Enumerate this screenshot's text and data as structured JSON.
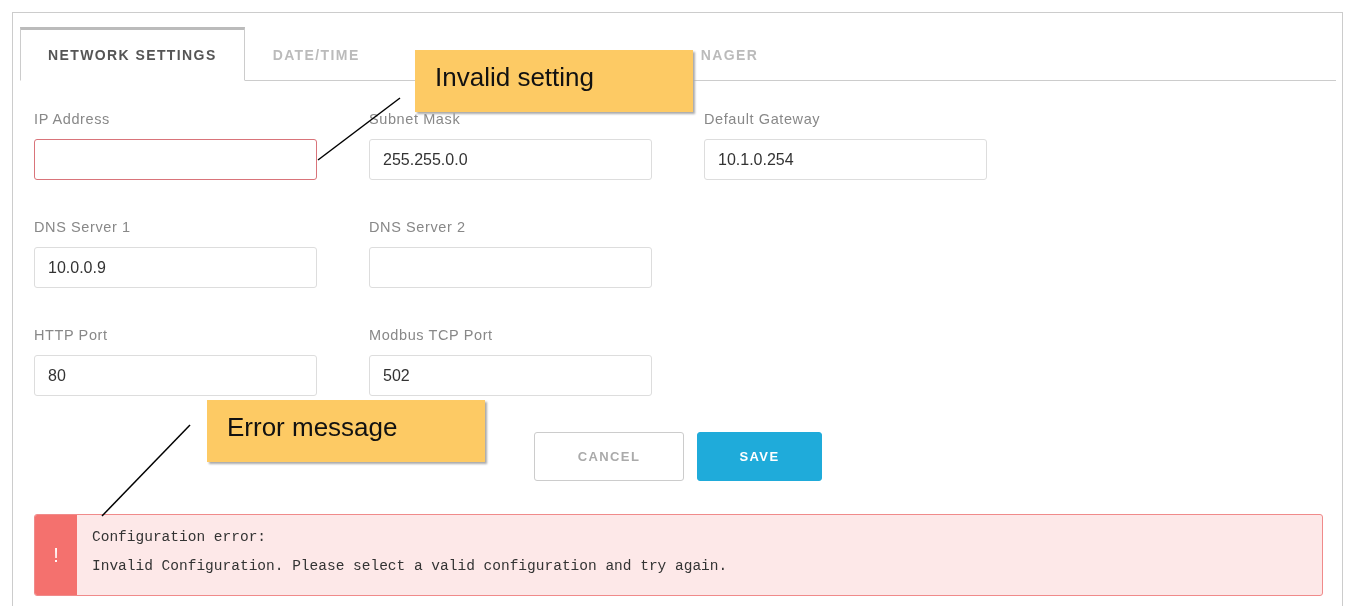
{
  "tabs": [
    {
      "label": "NETWORK SETTINGS",
      "selected": true
    },
    {
      "label": "DATE/TIME",
      "selected": false
    },
    {
      "label": "NAGER",
      "selected": false
    }
  ],
  "form": {
    "rows": [
      {
        "fields": [
          {
            "label": "IP Address",
            "invalid": true
          },
          {
            "label": "Subnet Mask",
            "value": "255.255.0.0",
            "invalid": false
          },
          {
            "label": "Default Gateway",
            "value": "10.1.0.254",
            "invalid": false
          }
        ]
      },
      {
        "fields": [
          {
            "label": "DNS Server 1",
            "value": "10.0.0.9",
            "invalid": false
          },
          {
            "label": "DNS Server 2",
            "invalid": false
          }
        ]
      },
      {
        "fields": [
          {
            "label": "HTTP Port",
            "value": "80",
            "invalid": false
          },
          {
            "label": "Modbus TCP Port",
            "value": "502",
            "invalid": false
          }
        ]
      }
    ]
  },
  "buttons": [
    {
      "label": "CANCEL",
      "kind": "secondary"
    },
    {
      "label": "SAVE",
      "kind": "primary"
    }
  ],
  "error": {
    "icon": "!",
    "title": "Configuration error:",
    "message": "Invalid Configuration. Please select a valid configuration and try again."
  },
  "annotations": [
    {
      "text": "Invalid setting"
    },
    {
      "text": "Error message"
    }
  ]
}
